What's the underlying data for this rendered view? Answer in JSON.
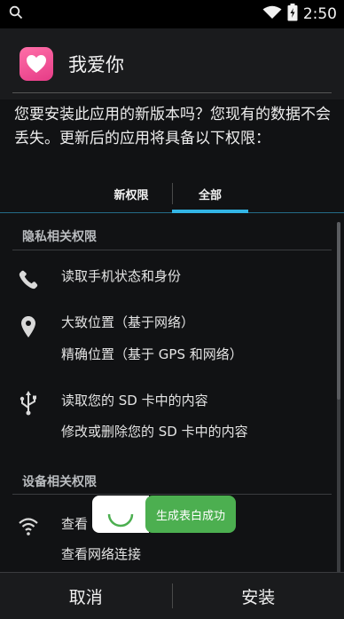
{
  "status_bar": {
    "time": "2:50"
  },
  "app": {
    "title": "我爱你"
  },
  "intro_text": "您要安装此应用的新版本吗？您现有的数据不会丢失。更新后的应用将具备以下权限：",
  "tabs": [
    {
      "label": "新权限",
      "selected": false
    },
    {
      "label": "全部",
      "selected": true
    }
  ],
  "sections": [
    {
      "title": "隐私相关权限",
      "groups": [
        {
          "icon": "phone-icon",
          "items": [
            "读取手机状态和身份"
          ]
        },
        {
          "icon": "location-pin-icon",
          "items": [
            "大致位置（基于网络）",
            "精确位置（基于 GPS 和网络）"
          ]
        },
        {
          "icon": "usb-icon",
          "items": [
            "读取您的 SD 卡中的内容",
            "修改或删除您的 SD 卡中的内容"
          ]
        }
      ]
    },
    {
      "title": "设备相关权限",
      "groups": [
        {
          "icon": "wifi-icon",
          "items": [
            "查看",
            "查看网络连接"
          ]
        }
      ]
    }
  ],
  "toast": {
    "message": "生成表白成功"
  },
  "buttons": {
    "cancel": "取消",
    "install": "安装"
  },
  "colors": {
    "accent": "#33b5e5",
    "toast": "#4caf50",
    "app_icon": "#e63c87"
  }
}
